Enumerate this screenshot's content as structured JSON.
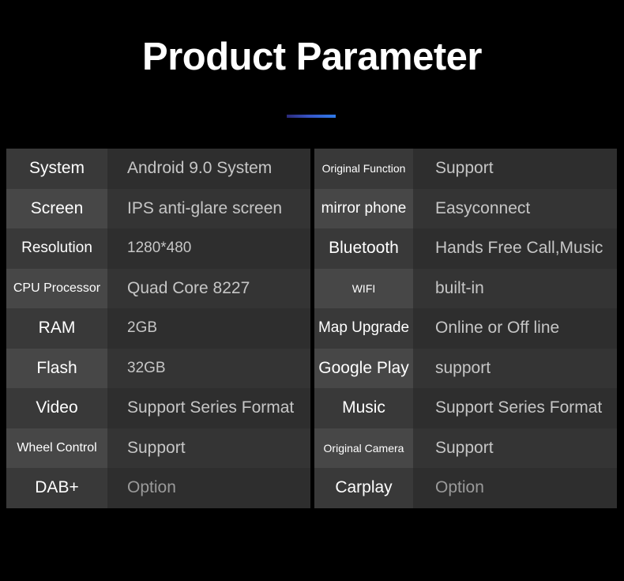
{
  "header": {
    "title": "Product Parameter",
    "accent_color": "#2f7bea",
    "background_color": "#000000"
  },
  "table": {
    "label_text_color": "#ffffff",
    "value_text_color": "#c6c6c6",
    "dim_value_color": "#9a9a9a",
    "row_color_odd_label": "#393939",
    "row_color_odd_value": "#2e2e2e",
    "row_color_even_label": "#474747",
    "row_color_even_value": "#343434",
    "left_column": [
      {
        "label": "System",
        "value": "Android 9.0 System"
      },
      {
        "label": "Screen",
        "value": "IPS anti-glare screen"
      },
      {
        "label": "Resolution",
        "value": "1280*480"
      },
      {
        "label": "CPU Processor",
        "value": "Quad Core 8227"
      },
      {
        "label": "RAM",
        "value": "2GB"
      },
      {
        "label": "Flash",
        "value": "32GB"
      },
      {
        "label": "Video",
        "value": "Support Series Format"
      },
      {
        "label": "Wheel Control",
        "value": "Support"
      },
      {
        "label": "DAB+",
        "value": "Option"
      }
    ],
    "right_column": [
      {
        "label": "Original Function",
        "value": "Support"
      },
      {
        "label": "mirror phone",
        "value": "Easyconnect"
      },
      {
        "label": "Bluetooth",
        "value": "Hands Free Call,Music"
      },
      {
        "label": "WIFI",
        "value": "built-in"
      },
      {
        "label": "Map Upgrade",
        "value": "Online or Off line"
      },
      {
        "label": "Google Play",
        "value": "support"
      },
      {
        "label": "Music",
        "value": "Support Series Format"
      },
      {
        "label": "Original Camera",
        "value": "Support"
      },
      {
        "label": "Carplay",
        "value": "Option"
      }
    ]
  }
}
